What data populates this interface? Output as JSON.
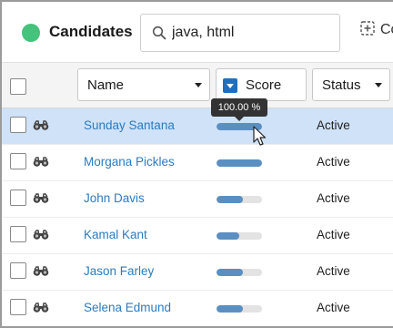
{
  "header": {
    "title": "Candidates",
    "status_color": "#45c27b",
    "search_value": "java, html",
    "search_icon": "search-icon",
    "columns_label": "Co",
    "columns_icon": "add-column-icon"
  },
  "columns": {
    "name_label": "Name",
    "score_label": "Score",
    "status_label": "Status"
  },
  "tooltip": "100.00 %",
  "rows": [
    {
      "name": "Sunday Santana",
      "score_pct": 100,
      "status": "Active",
      "icon": "binoculars-icon",
      "selected": true
    },
    {
      "name": "Morgana Pickles",
      "score_pct": 100,
      "status": "Active",
      "icon": "binoculars-icon",
      "selected": false
    },
    {
      "name": "John Davis",
      "score_pct": 58,
      "status": "Active",
      "icon": "binoculars-icon",
      "selected": false
    },
    {
      "name": "Kamal Kant",
      "score_pct": 50,
      "status": "Active",
      "icon": "binoculars-icon",
      "selected": false
    },
    {
      "name": "Jason Farley",
      "score_pct": 58,
      "status": "Active",
      "icon": "binoculars-icon",
      "selected": false
    },
    {
      "name": "Selena Edmund",
      "score_pct": 58,
      "status": "Active",
      "icon": "binoculars-icon",
      "selected": false
    }
  ]
}
